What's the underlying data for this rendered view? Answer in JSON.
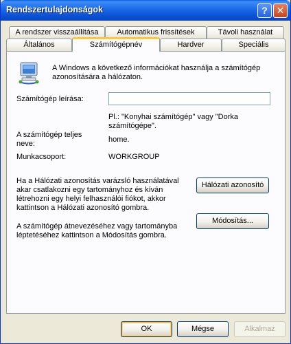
{
  "window": {
    "title": "Rendszertulajdonságok"
  },
  "titlebar": {
    "help_glyph": "?",
    "close_glyph": "✕"
  },
  "tabs": {
    "row1": [
      "A rendszer visszaállítása",
      "Automatikus frissítések",
      "Távoli használat"
    ],
    "row2": [
      "Általános",
      "Számítógépnév",
      "Hardver",
      "Speciális"
    ],
    "active": "Számítógépnév"
  },
  "panel": {
    "intro": "A Windows a következő információkat használja a számítógép azonosítására a hálózaton.",
    "description_label": "Számítógép leírása:",
    "description_value": "",
    "example": "Pl.: \"Konyhai számítógép\" vagy \"Dorka számítógépe\".",
    "full_name_label": "A számítógép teljes neve:",
    "full_name_value": "home.",
    "workgroup_label": "Munkacsoport:",
    "workgroup_value": "WORKGROUP",
    "network_id_text": "Ha a Hálózati azonosítás varázsló használatával akar csatlakozni egy tartományhoz és kíván létrehozni egy helyi felhasználói fiókot, akkor kattintson a Hálózati azonosító gombra.",
    "network_id_button": "Hálózati azonosító",
    "rename_text": "A számítógép átnevezéséhez vagy tartományba léptetéséhez kattintson a Módosítás gombra.",
    "rename_button": "Módosítás..."
  },
  "footer": {
    "ok": "OK",
    "cancel": "Mégse",
    "apply": "Alkalmaz"
  },
  "icons": {
    "computer": "computer-network-icon"
  },
  "colors": {
    "titlebar": "#0B53D6",
    "dialog_bg": "#ECE9D8",
    "active_tab_accent": "#FFC83C"
  }
}
